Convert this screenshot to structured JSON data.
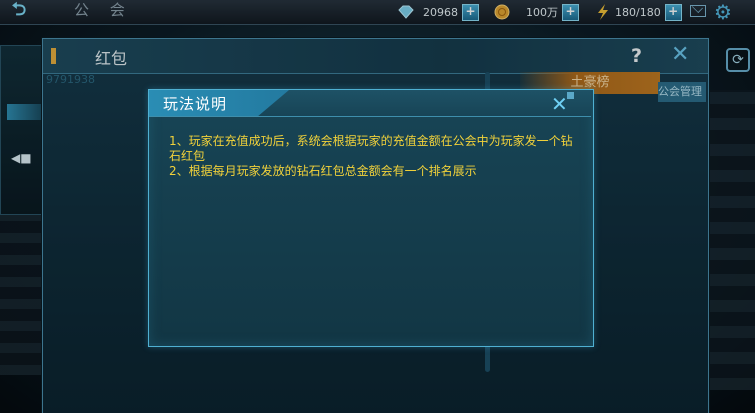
{
  "topbar": {
    "title": "公 会",
    "diamonds": "20968",
    "gold": "100万",
    "energy": "180/180",
    "plus": "+"
  },
  "window": {
    "title": "红包",
    "help": "?",
    "id_text": "9791938",
    "rich_tab": "土豪榜",
    "manage": "公会管理"
  },
  "dialog": {
    "title": "玩法说明",
    "lines": [
      "1、玩家在充值成功后，系统会根据玩家的充值金额在公会中为玩家发一个钻石红包",
      "2、根据每月玩家发放的钻石红包总金额会有一个排名展示"
    ]
  },
  "colors": {
    "rule_text": "#f2d23a",
    "accent": "#4fb0d2",
    "rich_tab": "#b06c1c"
  },
  "icons": [
    "back-icon",
    "diamond-icon",
    "coin-icon",
    "lightning-icon",
    "mail-icon",
    "gear-icon",
    "help-icon",
    "close-icon",
    "megaphone-icon",
    "refresh-icon"
  ]
}
